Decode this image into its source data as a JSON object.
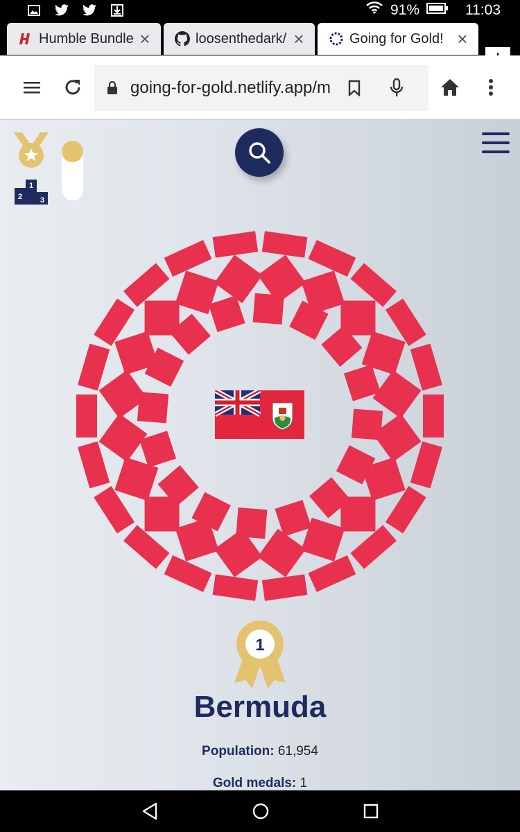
{
  "status_bar": {
    "battery": "91%",
    "time": "11:03",
    "left_icons": [
      "gallery-icon",
      "twitter-icon",
      "twitter-icon",
      "download-icon"
    ]
  },
  "tabs": [
    {
      "title": "Humble Bundle",
      "favicon": "humble-icon",
      "active": false
    },
    {
      "title": "loosenthedark/",
      "favicon": "github-icon",
      "active": false
    },
    {
      "title": "Going for Gold!",
      "favicon": "rings-icon",
      "active": true
    }
  ],
  "new_tab_label": "+",
  "toolbar": {
    "url": "going-for-gold.netlify.app/m"
  },
  "page": {
    "country": "Bermuda",
    "rank": "1",
    "population_label": "Population:",
    "population_value": "61,954",
    "gold_label": "Gold medals:",
    "gold_value": "1",
    "accent_color": "#e8304f",
    "navy_color": "#1e2b5e",
    "gold_color": "#e4c36f",
    "podium_numbers": [
      "1",
      "2",
      "3"
    ]
  }
}
